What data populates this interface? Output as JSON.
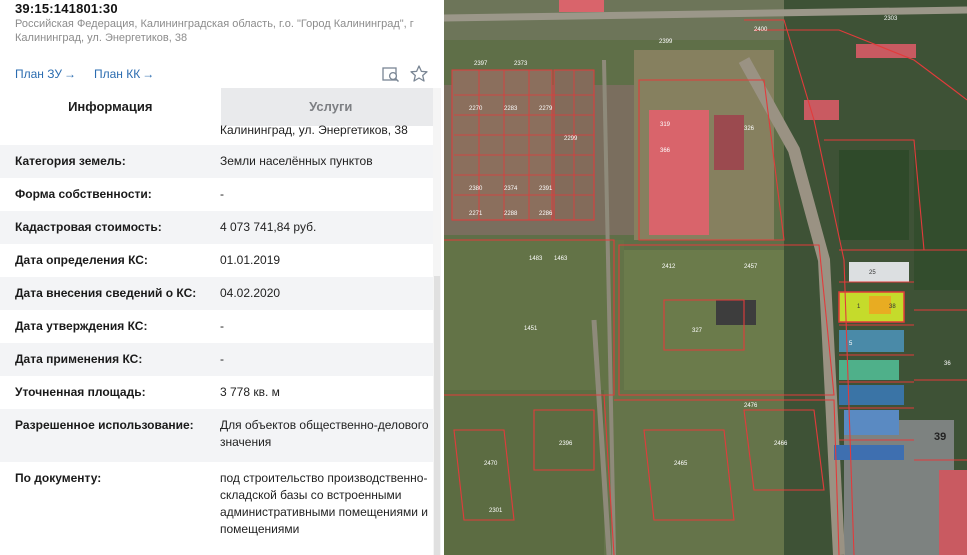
{
  "parcel": {
    "cadastral_number": "39:15:141801:30",
    "address": "Российская Федерация, Калининградская область, г.о. \"Город Калининград\", г Калининград, ул. Энергетиков, 38"
  },
  "links": {
    "plan_zu": "План ЗУ",
    "plan_kk": "План КК",
    "arrow": "→"
  },
  "tools": {
    "search_icon": "search-map-icon",
    "favorite_icon": "star-icon"
  },
  "tabs": [
    {
      "label": "Информация",
      "active": true
    },
    {
      "label": "Услуги",
      "active": false
    }
  ],
  "address_cutoff": "Калининград, ул. Энергетиков, 38",
  "fields": [
    {
      "label": "Категория земель:",
      "value": "Земли населённых пунктов"
    },
    {
      "label": "Форма собственности:",
      "value": "-"
    },
    {
      "label": "Кадастровая стоимость:",
      "value": "4 073 741,84 руб."
    },
    {
      "label": "Дата определения КС:",
      "value": "01.01.2019"
    },
    {
      "label": "Дата внесения сведений о КС:",
      "value": "04.02.2020"
    },
    {
      "label": "Дата утверждения КС:",
      "value": "-"
    },
    {
      "label": "Дата применения КС:",
      "value": "-"
    },
    {
      "label": "Уточненная площадь:",
      "value": "3 778 кв. м"
    },
    {
      "label": "Разрешенное использование:",
      "value": "Для объектов общественно-делового значения"
    },
    {
      "label": "По документу:",
      "value": "под строительство производственно-складской базы со встроенными административными помещениями и помещениями"
    }
  ],
  "map": {
    "labels": [
      "39",
      "25",
      "319",
      "366",
      "1483",
      "1451",
      "2412",
      "2457",
      "1463",
      "327",
      "2397",
      "2373",
      "2301",
      "2396",
      "2470",
      "2465",
      "2466",
      "2476",
      "326",
      "2399",
      "2400",
      "2303",
      "1",
      "38",
      "5",
      "36",
      "2380",
      "2374",
      "2391",
      "2271",
      "2288",
      "2286",
      "2270",
      "2283",
      "2279",
      "2299"
    ],
    "highlight_color": "#d4ea2a",
    "parcel_color": "#e23b3b"
  }
}
